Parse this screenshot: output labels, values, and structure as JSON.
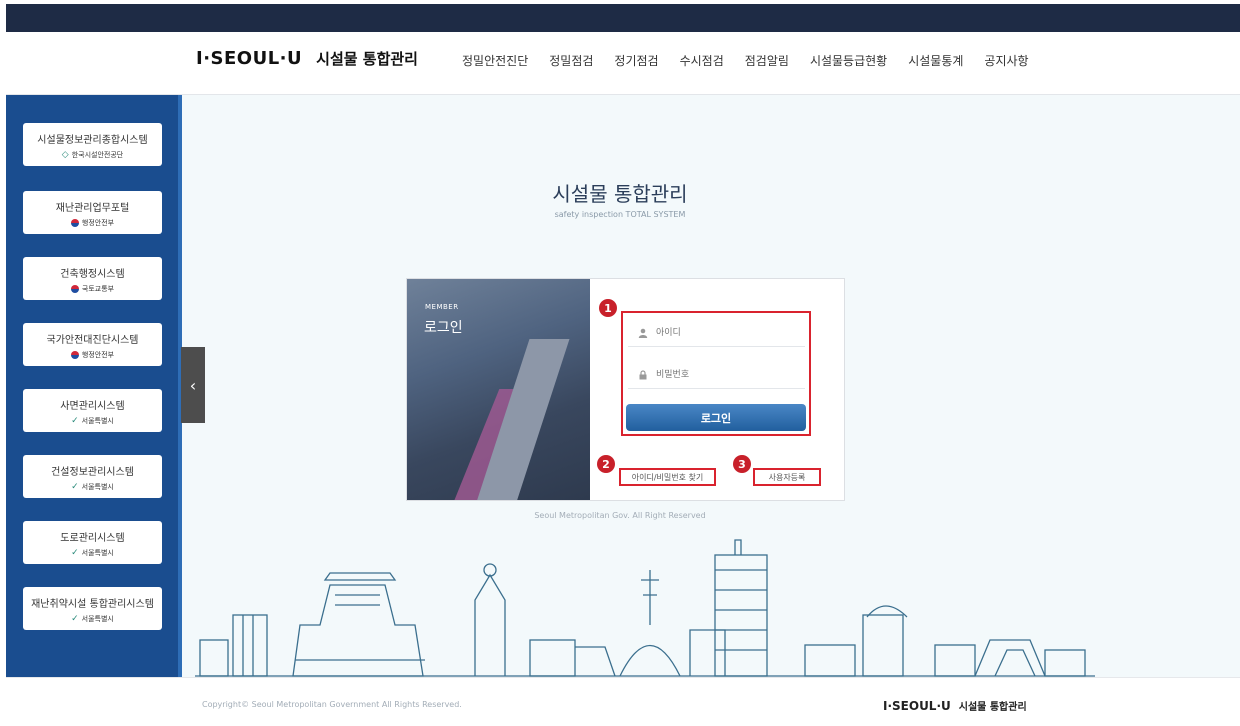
{
  "header": {
    "logo_mark": "I·SEOUL·U",
    "logo_text": "시설물 통합관리",
    "nav": [
      "정밀안전진단",
      "정밀점검",
      "정기점검",
      "수시점검",
      "점검알림",
      "시설물등급현황",
      "시설물통계",
      "공지사항"
    ]
  },
  "sidebar": {
    "items": [
      {
        "label": "시설물정보관리종합시스템",
        "org": "한국시설안전공단",
        "icon": "kistec-logo-icon"
      },
      {
        "label": "재난관리업무포털",
        "org": "행정안전부",
        "icon": "taegeuk-icon"
      },
      {
        "label": "건축행정시스템",
        "org": "국토교통부",
        "icon": "taegeuk-icon"
      },
      {
        "label": "국가안전대진단시스템",
        "org": "행정안전부",
        "icon": "taegeuk-icon"
      },
      {
        "label": "사면관리시스템",
        "org": "서울특별시",
        "icon": "seoul-logo-icon"
      },
      {
        "label": "건설정보관리시스템",
        "org": "서울특별시",
        "icon": "seoul-logo-icon"
      },
      {
        "label": "도로관리시스템",
        "org": "서울특별시",
        "icon": "seoul-logo-icon"
      },
      {
        "label": "재난취약시설 통합관리시스템",
        "org": "서울특별시",
        "icon": "seoul-logo-icon"
      }
    ],
    "toggle_icon": "chevron-left-icon",
    "toggle_glyph": "‹"
  },
  "main": {
    "title": "시설물 통합관리",
    "subtitle": "safety inspection TOTAL SYSTEM",
    "login": {
      "member_label": "MEMBER",
      "heading": "로그인",
      "id_placeholder": "아이디",
      "pw_placeholder": "비밀번호",
      "button": "로그인",
      "find_link": "아이디/비밀번호 찾기",
      "register_link": "사용자등록"
    },
    "badges": [
      "1",
      "2",
      "3"
    ],
    "rights": "Seoul Metropolitan Gov. All Right Reserved"
  },
  "footer": {
    "copyright": "Copyright© Seoul Metropolitan Government All Rights Reserved.",
    "logo_mark": "I·SEOUL·U",
    "logo_text": "시설물 통합관리"
  },
  "colors": {
    "topbar": "#1e2b45",
    "sidebar": "#1a4d8f",
    "accent_red": "#d9232e",
    "button_blue": "#215f9e"
  }
}
